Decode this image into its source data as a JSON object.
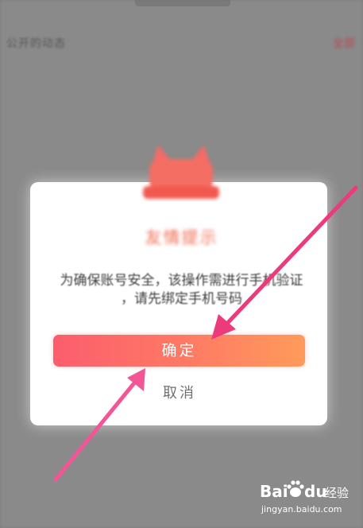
{
  "background": {
    "left_text": "公开的动态",
    "right_text": "全部"
  },
  "dialog": {
    "title": "友情提示",
    "message_line1": "为确保账号安全，该操作需进行手机验证",
    "message_line2": "，请先绑定手机号码",
    "confirm_label": "确定",
    "cancel_label": "取消"
  },
  "watermark": {
    "logo_text": "Bai",
    "logo_du": "du",
    "jingyan": "经验",
    "domain": "jingyan.baidu.com"
  },
  "colors": {
    "accent_start": "#fc5d6d",
    "accent_end": "#ff9b5a",
    "arrow": "#f2407e",
    "title": "#ef6a4f"
  }
}
